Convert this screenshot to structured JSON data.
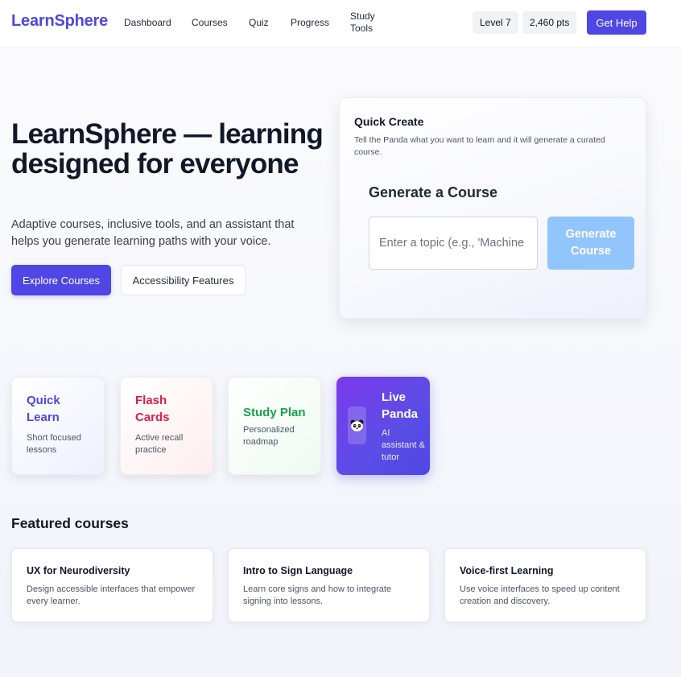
{
  "header": {
    "brand": "LearnSphere",
    "nav": [
      {
        "label": "Dashboard"
      },
      {
        "label": "Courses"
      },
      {
        "label": "Quiz"
      },
      {
        "label": "Progress"
      },
      {
        "label_line1": "Study",
        "label_line2": "Tools"
      }
    ],
    "level": "Level 7",
    "points": "2,460 pts",
    "help_button": "Get Help"
  },
  "hero": {
    "title": "LearnSphere — learning designed for everyone",
    "subtitle": "Adaptive courses, inclusive tools, and an assistant that helps you generate learning paths with your voice.",
    "primary_button": "Explore Courses",
    "secondary_button": "Accessibility Features"
  },
  "quick_create": {
    "title": "Quick Create",
    "description": "Tell the Panda what you want to learn and it will generate a curated course.",
    "generate_title": "Generate a Course",
    "input_placeholder": "Enter a topic (e.g., 'Machine Learning')",
    "input_value": "",
    "generate_button": "Generate Course",
    "button_color": "#93c5fd"
  },
  "features": [
    {
      "title": "Quick Learn",
      "desc": "Short focused lessons",
      "color": "#4f46e5"
    },
    {
      "title": "Flash Cards",
      "desc": "Active recall practice",
      "color": "#e11d48"
    },
    {
      "title": "Study Plan",
      "desc": "Personalized roadmap",
      "color": "#16a34a"
    },
    {
      "title": "Live Panda",
      "desc": "AI assistant & tutor",
      "icon": "panda-icon",
      "color": "#7c3aed"
    }
  ],
  "featured": {
    "title": "Featured courses",
    "courses": [
      {
        "title": "UX for Neurodiversity",
        "desc": "Design accessible interfaces that empower every learner."
      },
      {
        "title": "Intro to Sign Language",
        "desc": "Learn core signs and how to integrate signing into lessons."
      },
      {
        "title": "Voice-first Learning",
        "desc": "Use voice interfaces to speed up content creation and discovery."
      }
    ]
  },
  "colors": {
    "brand": "#4f46e5",
    "accent_primary": "#4f46e5"
  }
}
